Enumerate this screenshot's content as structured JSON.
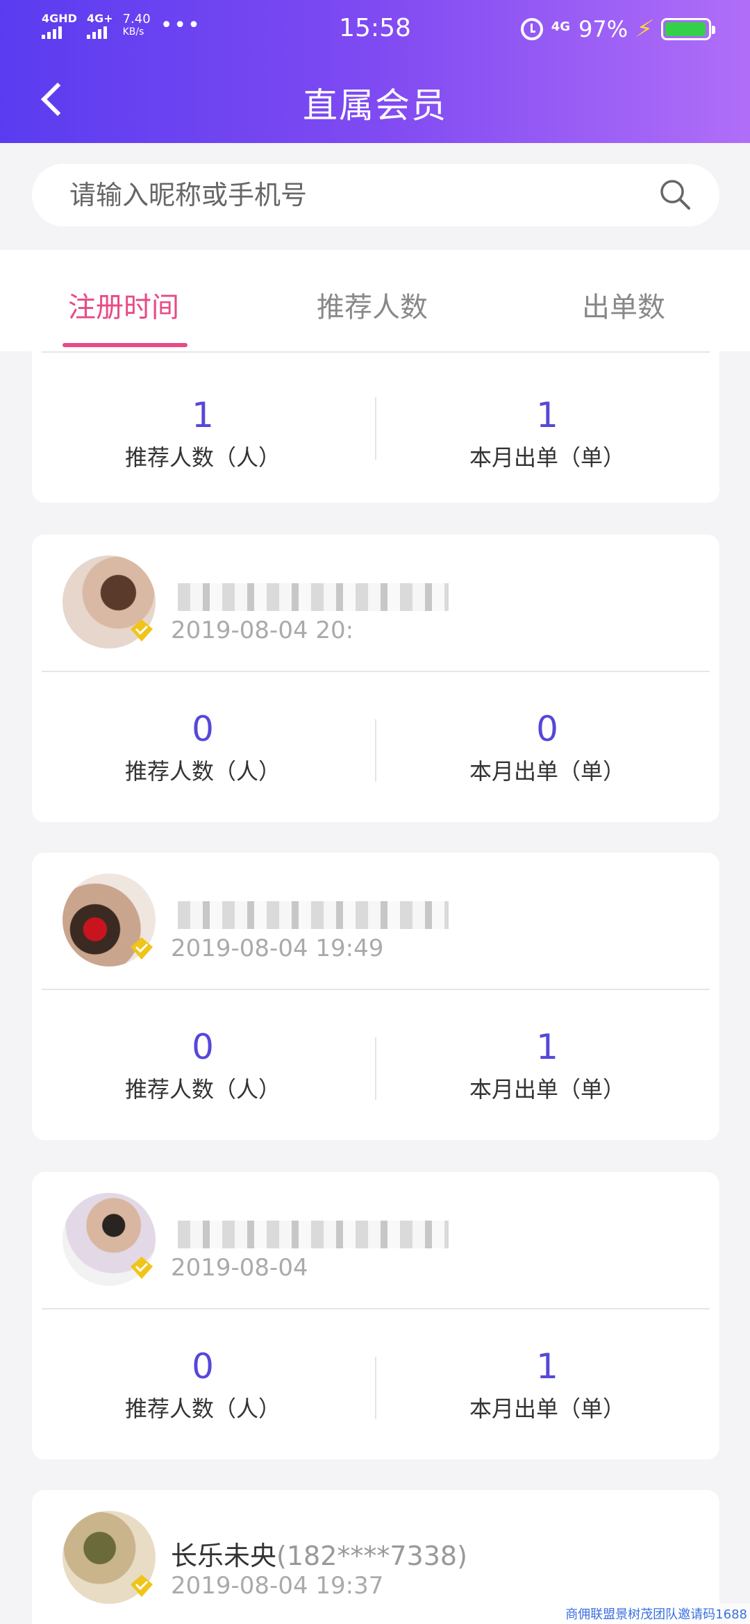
{
  "status_bar": {
    "sig1_label": "4GHD",
    "sig2_label": "4G+",
    "net_speed": "7.40",
    "net_unit": "KB/s",
    "more": "•••",
    "time": "15:58",
    "net_type": "4G",
    "battery": "97%"
  },
  "nav": {
    "title": "直属会员"
  },
  "search": {
    "placeholder": "请输入昵称或手机号",
    "value": ""
  },
  "tabs": [
    {
      "label": "注册时间",
      "active": true
    },
    {
      "label": "推荐人数",
      "active": false
    },
    {
      "label": "出单数",
      "active": false
    }
  ],
  "colors": {
    "accent": "#e84a86",
    "stat_value": "#5548d8",
    "header_start": "#5a3cf0",
    "header_end": "#b06ef8"
  },
  "members": [
    {
      "name": "",
      "phone": "",
      "date": "",
      "referrals": "1",
      "referrals_label": "推荐人数（人）",
      "orders": "1",
      "orders_label": "本月出单（单）"
    },
    {
      "name": "",
      "phone": "",
      "date": "2019-08-04 20:",
      "referrals": "0",
      "referrals_label": "推荐人数（人）",
      "orders": "0",
      "orders_label": "本月出单（单）"
    },
    {
      "name": "",
      "phone": "",
      "date": "2019-08-04 19:49",
      "referrals": "0",
      "referrals_label": "推荐人数（人）",
      "orders": "1",
      "orders_label": "本月出单（单）"
    },
    {
      "name": "",
      "phone": "",
      "date": "2019-08-04",
      "referrals": "0",
      "referrals_label": "推荐人数（人）",
      "orders": "1",
      "orders_label": "本月出单（单）"
    },
    {
      "name": "长乐未央",
      "phone": "(182****7338)",
      "date": "2019-08-04 19:37"
    }
  ],
  "watermark": "商佣联盟景树茂团队邀请码1688"
}
